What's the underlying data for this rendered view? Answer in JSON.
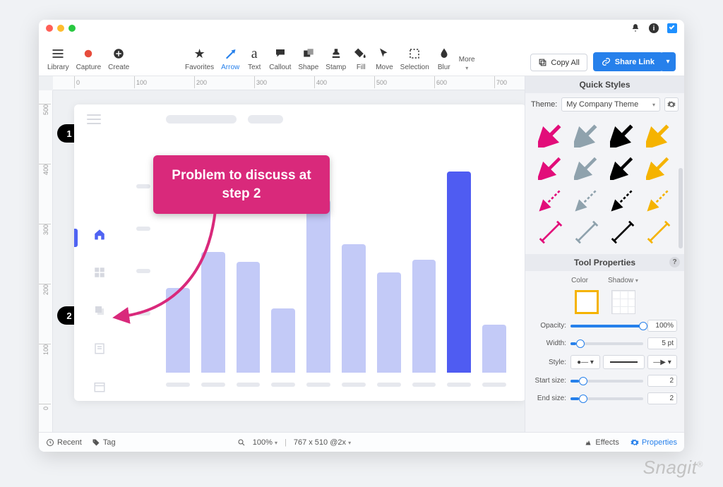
{
  "watermark": "Snagit",
  "toolbar": {
    "library": "Library",
    "capture": "Capture",
    "create": "Create",
    "favorites": "Favorites",
    "arrow": "Arrow",
    "text": "Text",
    "callout": "Callout",
    "shape": "Shape",
    "stamp": "Stamp",
    "fill": "Fill",
    "move": "Move",
    "selection": "Selection",
    "blur": "Blur",
    "more": "More",
    "copyall": "Copy All",
    "share": "Share Link"
  },
  "ruler": {
    "h": [
      "0",
      "100",
      "200",
      "300",
      "400",
      "500",
      "600",
      "700"
    ],
    "v": [
      "500",
      "400",
      "300",
      "200",
      "100",
      "0"
    ]
  },
  "callout_text": "Problem to discuss at step 2",
  "step_markers": [
    "1",
    "2"
  ],
  "right": {
    "quickstyles": "Quick Styles",
    "theme_label": "Theme:",
    "theme_value": "My Company Theme",
    "toolprops": "Tool Properties",
    "color": "Color",
    "shadow": "Shadow",
    "opacity": "Opacity:",
    "opacity_val": "100%",
    "width": "Width:",
    "width_val": "5 pt",
    "style": "Style:",
    "start": "Start size:",
    "start_val": "2",
    "end": "End size:",
    "end_val": "2"
  },
  "status": {
    "recent": "Recent",
    "tag": "Tag",
    "zoom": "100%",
    "dims": "767 x 510 @2x",
    "effects": "Effects",
    "properties": "Properties"
  },
  "chart_data": {
    "type": "bar",
    "categories": [
      "",
      "",
      "",
      "",
      "",
      "",
      "",
      "",
      "",
      ""
    ],
    "values": [
      42,
      60,
      55,
      32,
      86,
      64,
      50,
      56,
      100,
      24
    ],
    "highlight_index": 8,
    "ylim": [
      0,
      100
    ],
    "title": "",
    "xlabel": "",
    "ylabel": ""
  },
  "colors": {
    "accent": "#2680eb",
    "callout": "#d9297b",
    "swatches": [
      "#e20d7a",
      "#8fa2ad",
      "#000000",
      "#f5b300"
    ]
  }
}
